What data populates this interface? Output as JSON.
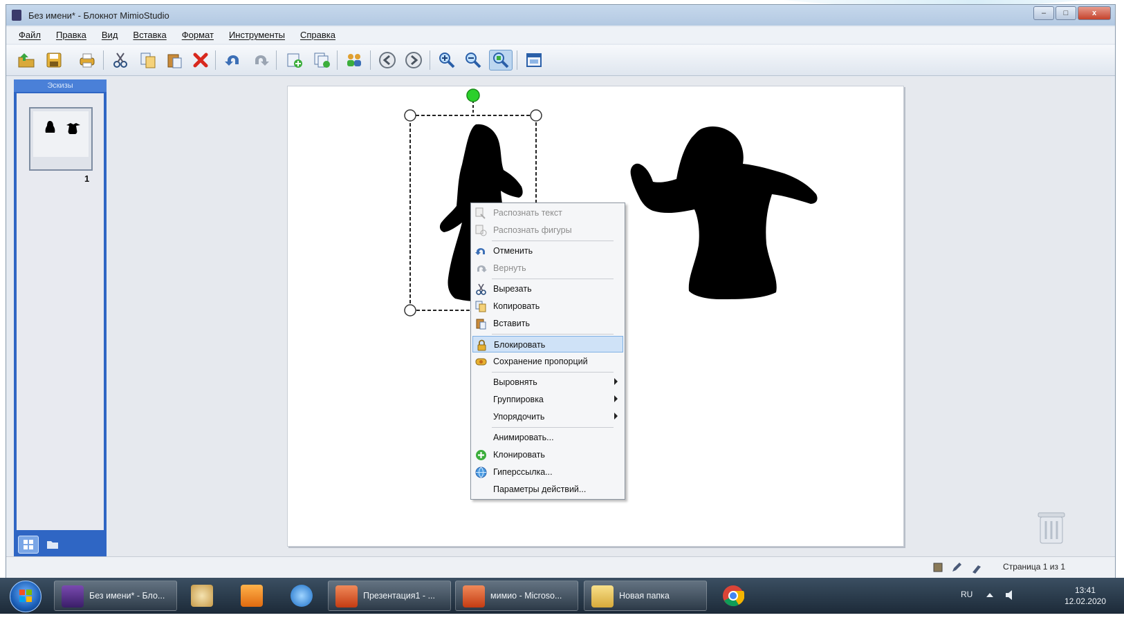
{
  "window": {
    "title": "Без имени* - Блокнот MimioStudio",
    "controls": [
      "–",
      "□",
      "x"
    ]
  },
  "menubar": [
    "Файл",
    "Правка",
    "Вид",
    "Вставка",
    "Формат",
    "Инструменты",
    "Справка"
  ],
  "toolbar": {
    "icons": [
      "open-icon",
      "save-icon",
      "print-icon",
      "cut-icon",
      "copy-icon",
      "paste-icon",
      "delete-icon",
      "undo-icon",
      "redo-icon",
      "add-page-icon",
      "duplicate-page-icon",
      "users-icon",
      "back-icon",
      "forward-icon",
      "zoom-in-icon",
      "zoom-out-icon",
      "zoom-fit-icon",
      "view-icon"
    ],
    "active_icon": "zoom-fit-icon"
  },
  "sidebar": {
    "header": "Эскизы",
    "page_number": "1"
  },
  "context_menu": {
    "items": [
      {
        "label": "Распознать текст",
        "icon": "recognize-text-icon",
        "disabled": true
      },
      {
        "label": "Распознать фигуры",
        "icon": "recognize-shapes-icon",
        "disabled": true
      },
      {
        "label": "Отменить",
        "icon": "undo-icon",
        "disabled": false
      },
      {
        "label": "Вернуть",
        "icon": "redo-icon",
        "disabled": true
      },
      {
        "label": "Вырезать",
        "icon": "cut-icon",
        "disabled": false
      },
      {
        "label": "Копировать",
        "icon": "copy-icon",
        "disabled": false
      },
      {
        "label": "Вставить",
        "icon": "paste-icon",
        "disabled": false
      },
      {
        "label": "Блокировать",
        "icon": "lock-icon",
        "disabled": false,
        "highlighted": true
      },
      {
        "label": "Сохранение пропорций",
        "icon": "aspect-ratio-icon",
        "disabled": false
      },
      {
        "label": "Выровнять",
        "submenu": true
      },
      {
        "label": "Группировка",
        "submenu": true
      },
      {
        "label": "Упорядочить",
        "submenu": true
      },
      {
        "label": "Анимировать...",
        "disabled": false
      },
      {
        "label": "Клонировать",
        "icon": "clone-icon",
        "disabled": false
      },
      {
        "label": "Гиперссылка...",
        "icon": "hyperlink-icon",
        "disabled": false
      },
      {
        "label": "Параметры действий...",
        "disabled": false
      }
    ]
  },
  "statusbar": {
    "page_info": "Страница 1 из 1"
  },
  "taskbar": {
    "items": [
      {
        "label": "Без имени* - Бло...",
        "icon": "mimio-icon"
      },
      {
        "label": "",
        "icon": "paint-icon"
      },
      {
        "label": "",
        "icon": "media-player-icon"
      },
      {
        "label": "",
        "icon": "internet-explorer-icon"
      },
      {
        "label": "Презентация1 - ...",
        "icon": "powerpoint-icon"
      },
      {
        "label": "мимио - Microso...",
        "icon": "powerpoint-icon"
      },
      {
        "label": "Новая папка",
        "icon": "folder-icon"
      },
      {
        "label": "",
        "icon": "chrome-icon"
      }
    ],
    "language": "RU",
    "time": "13:41",
    "date": "12.02.2020"
  }
}
